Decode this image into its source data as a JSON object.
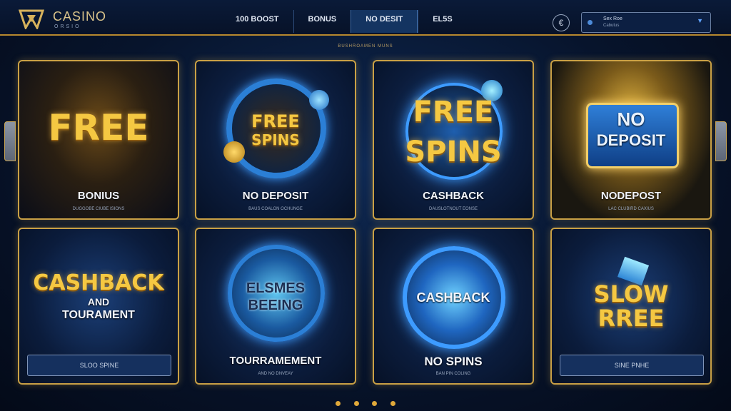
{
  "header": {
    "brand": "CASINO",
    "brand_sub": "ORSIO",
    "nav": [
      "100 BOOST",
      "BONUS",
      "NO DESIT",
      "EL5S"
    ],
    "active_nav_index": 2,
    "icon_button": "€",
    "account": {
      "line1": "Sex Roe",
      "line2": "Cabutus"
    }
  },
  "subtitle": "BUSHROAMEN MUNS",
  "cards": [
    {
      "art": "FREE",
      "title": "BONIUS",
      "small": "DUGGOBE CIUBE ISIONS"
    },
    {
      "art_line1": "FREE",
      "art_line2": "SPINS",
      "title": "NO DEPOSIT",
      "small": "BAUS COALON OCHUNGE"
    },
    {
      "art_line1": "FREE",
      "art_line2": "SPINS",
      "title": "CASHBACK",
      "small": "DAUSLOTNOUT EONSE"
    },
    {
      "art_line1": "NO",
      "art_line2": "DEPOSIT",
      "title": "NODEPOST",
      "small": "LAC CLUBIRD CAXIUS"
    },
    {
      "art_line1": "CASHBACK",
      "art_line2": "AND",
      "art_line3": "TOURAMENT",
      "button": "SLOO SPINE"
    },
    {
      "art_line1": "ELSMES",
      "art_line2": "BEEING",
      "title": "TOURRAMEMENT",
      "small": "AND NO DNVEAY"
    },
    {
      "art": "CASHBACK",
      "title": "NO SPINS",
      "small": "BAN PIN COLING"
    },
    {
      "art_line1": "SLOW",
      "art_line2": "RREE",
      "button": "SINE PNHE"
    }
  ],
  "pagination": {
    "count": 4
  },
  "colors": {
    "gold": "#c9a045",
    "navy": "#07142c",
    "accent_blue": "#3d9bff"
  }
}
